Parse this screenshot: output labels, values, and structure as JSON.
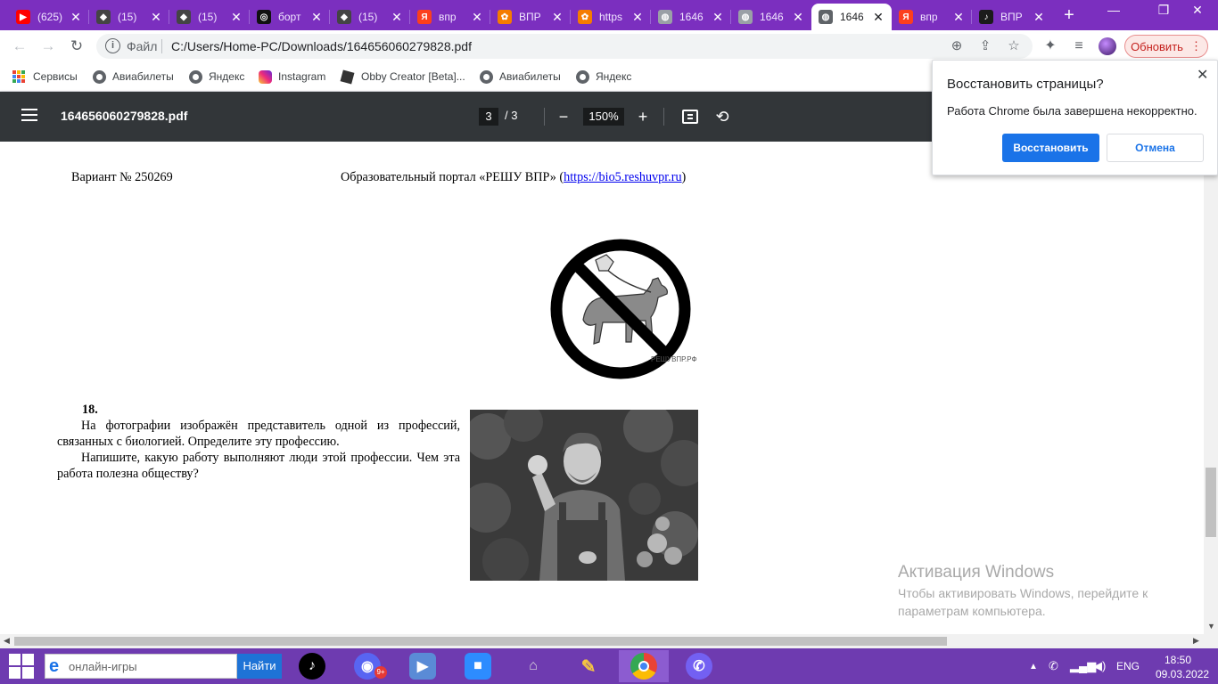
{
  "tabs": [
    {
      "label": "(625)",
      "icon": "youtube-icon",
      "color": "#ff0000"
    },
    {
      "label": "(15)",
      "icon": "roblox-icon",
      "color": "#444444"
    },
    {
      "label": "(15)",
      "icon": "roblox-icon",
      "color": "#444444"
    },
    {
      "label": "борт",
      "icon": "blockchain-icon",
      "color": "#111111"
    },
    {
      "label": "(15)",
      "icon": "roblox-icon",
      "color": "#444444"
    },
    {
      "label": "впр",
      "icon": "yandex-icon",
      "color": "#fc3f1d"
    },
    {
      "label": "ВПР",
      "icon": "vpr-logo-icon",
      "color": "#f57c00"
    },
    {
      "label": "https",
      "icon": "vpr-logo-icon",
      "color": "#f57c00"
    },
    {
      "label": "1646",
      "icon": "globe-icon",
      "color": "#9aa0a6"
    },
    {
      "label": "1646",
      "icon": "globe-icon",
      "color": "#9aa0a6"
    },
    {
      "label": "1646",
      "icon": "globe-icon",
      "color": "#5f6368"
    },
    {
      "label": "впр",
      "icon": "yandex-icon",
      "color": "#fc3f1d"
    },
    {
      "label": "ВПР",
      "icon": "music-note-icon",
      "color": "#1b1b1b"
    }
  ],
  "toolbar": {
    "scheme": "Файл",
    "url": "C:/Users/Home-PC/Downloads/164656060279828.pdf",
    "update_label": "Обновить"
  },
  "bookmarks": [
    {
      "label": "Сервисы",
      "icon": "apps-grid-icon"
    },
    {
      "label": "Авиабилеты",
      "icon": "globe-icon"
    },
    {
      "label": "Яндекс",
      "icon": "globe-icon"
    },
    {
      "label": "Instagram",
      "icon": "instagram-icon"
    },
    {
      "label": "Obby Creator [Beta]...",
      "icon": "roblox-icon"
    },
    {
      "label": "Авиабилеты",
      "icon": "globe-icon"
    },
    {
      "label": "Яндекс",
      "icon": "globe-icon"
    }
  ],
  "pdf": {
    "filename": "164656060279828.pdf",
    "page_current": "3",
    "page_total": "/  3",
    "zoom": "150%"
  },
  "doc": {
    "variant": "Вариант № 250269",
    "portal_text": "Образовательный портал «РЕШУ ВПР» (",
    "portal_link": "https://bio5.reshuvpr.ru",
    "portal_close": ")",
    "sign_watermark": "РЕШУВПР.РФ",
    "q_number": "18.",
    "q_para1": "На фотографии изображён представитель одной из профессий, связанных с биологией. Определите эту профессию.",
    "q_para2": "Напишите, какую работу выполняют люди этой профессии. Чем эта работа полезна обществу?"
  },
  "popup": {
    "title": "Восстановить страницы?",
    "message": "Работа Chrome была завершена некорректно.",
    "restore_label": "Восстановить",
    "cancel_label": "Отмена"
  },
  "watermark": {
    "title": "Активация Windows",
    "line1": "Чтобы активировать Windows, перейдите к",
    "line2": "параметрам компьютера."
  },
  "taskbar": {
    "search_text": "онлайн-игры",
    "find_label": "Найти",
    "discord_badge": "9+",
    "lang": "ENG",
    "time": "18:50",
    "date": "09.03.2022"
  }
}
